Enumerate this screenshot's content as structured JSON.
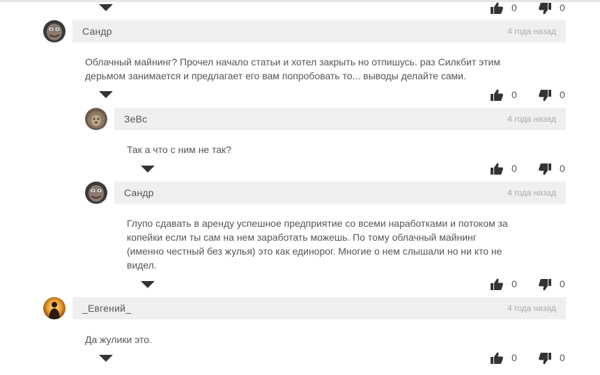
{
  "comments": [
    {
      "author": "Сандр",
      "date": "4 года назад",
      "text": [
        "Облачный майнинг? Прочел начало статьи и хотел закрыть но отпишусь. раз Силкбит этим",
        "дерьмом занимается и предлагает его вам попробовать то... выводы делайте сами."
      ],
      "likes": "0",
      "dislikes": "0",
      "avatar": "troll-face-avatar"
    },
    {
      "author": "ЗеВс",
      "date": "4 года назад",
      "text": [
        "Так а что с ним не так?"
      ],
      "likes": "0",
      "dislikes": "0",
      "avatar": "lion-avatar"
    },
    {
      "author": "Сандр",
      "date": "4 года назад",
      "text": [
        "Глупо сдавать в аренду успешное предприятие со всеми наработками и потоком за",
        "копейки если ты сам на нем заработать можешь. По тому облачный майнинг",
        "(именно честный без жулья) это как единорог. Многие о нем слышали но ни кто не",
        "видел."
      ],
      "likes": "0",
      "dislikes": "0",
      "avatar": "troll-face-avatar"
    },
    {
      "author": "_Евгений_",
      "date": "4 года назад",
      "text": [
        "Да жулики это."
      ],
      "likes": "0",
      "dislikes": "0",
      "avatar": "sunset-silhouette-avatar"
    }
  ],
  "top_votes": {
    "likes": "0",
    "dislikes": "0"
  }
}
